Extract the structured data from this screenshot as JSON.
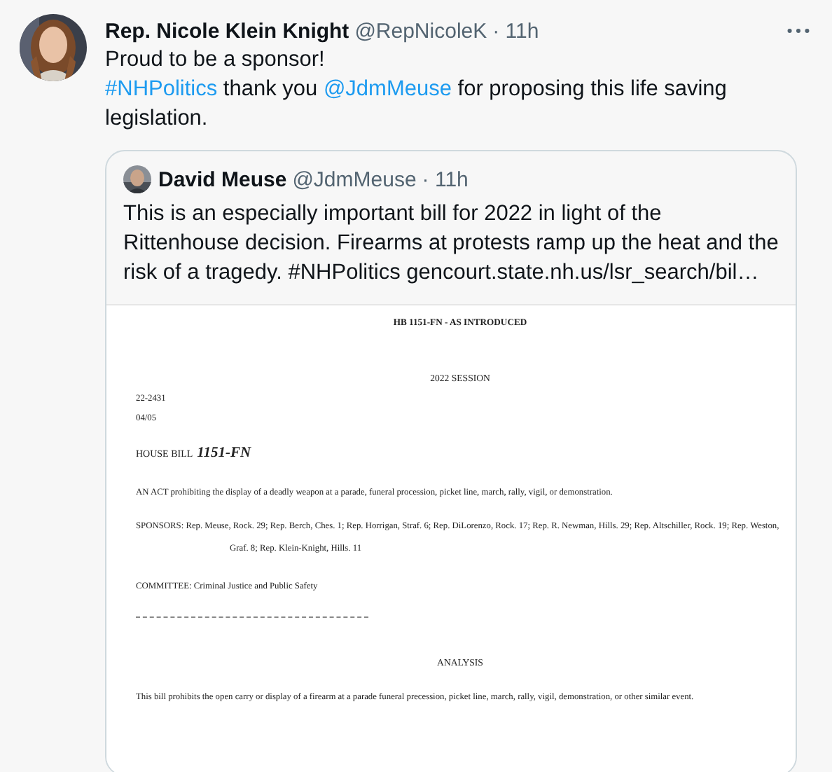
{
  "tweet": {
    "name": "Rep. Nicole Klein Knight",
    "handle": "@RepNicoleK",
    "time": "· 11h",
    "text_lines": [
      [
        {
          "kind": "text",
          "text": "Proud to be a sponsor!"
        }
      ],
      [
        {
          "kind": "link",
          "text": "#NHPolitics"
        },
        {
          "kind": "text",
          "text": " thank you "
        },
        {
          "kind": "link",
          "text": "@JdmMeuse"
        },
        {
          "kind": "text",
          "text": "  for proposing this life saving legislation."
        }
      ]
    ]
  },
  "quote": {
    "name": "David Meuse",
    "handle": "@JdmMeuse",
    "time": "· 11h",
    "text": "This is an especially important bill for 2022 in light of the Rittenhouse decision. Firearms at protests ramp up the heat and the risk of a tragedy. #NHPolitics gencourt.state.nh.us/lsr_search/bil…",
    "document": {
      "title": "HB 1151-FN - AS INTRODUCED",
      "session": "2022 SESSION",
      "number": "22-2431",
      "date": "04/05",
      "bill_label": "HOUSE BILL",
      "bill_number": "1151-FN",
      "act": "AN ACT prohibiting the display of a deadly weapon at a parade, funeral procession, picket line, march, rally, vigil, or demonstration.",
      "sponsors": "SPONSORS: Rep. Meuse, Rock. 29; Rep. Berch, Ches. 1; Rep. Horrigan, Straf. 6; Rep. DiLorenzo, Rock. 17; Rep. R. Newman, Hills. 29; Rep. Altschiller, Rock. 19; Rep. Weston, Graf. 8; Rep. Klein-Knight, Hills. 11",
      "committee": "COMMITTEE: Criminal Justice and Public Safety",
      "analysis_heading": "ANALYSIS",
      "analysis": "This bill prohibits the open carry or display of a firearm at a parade funeral precession, picket line, march, rally, vigil, demonstration, or other similar event."
    }
  }
}
